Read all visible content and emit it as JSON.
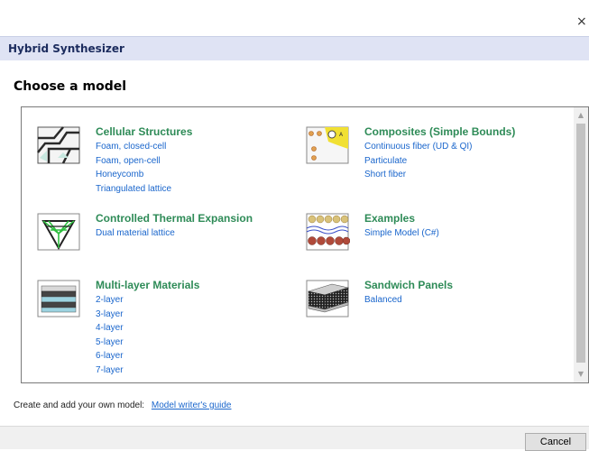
{
  "window": {
    "close_glyph": "×"
  },
  "header": {
    "title": "Hybrid Synthesizer"
  },
  "heading": "Choose a model",
  "categories": [
    {
      "title": "Cellular Structures",
      "icon": "cellular-structure-icon",
      "items": [
        "Foam, closed-cell",
        "Foam, open-cell",
        "Honeycomb",
        "Triangulated lattice"
      ]
    },
    {
      "title": "Composites (Simple Bounds)",
      "icon": "composite-icon",
      "items": [
        "Continuous fiber (UD & QI)",
        "Particulate",
        "Short fiber"
      ]
    },
    {
      "title": "Controlled Thermal Expansion",
      "icon": "lattice-icon",
      "items": [
        "Dual material lattice"
      ]
    },
    {
      "title": "Examples",
      "icon": "examples-icon",
      "items": [
        "Simple Model (C#)"
      ]
    },
    {
      "title": "Multi-layer Materials",
      "icon": "multilayer-icon",
      "items": [
        "2-layer",
        "3-layer",
        "4-layer",
        "5-layer",
        "6-layer",
        "7-layer"
      ]
    },
    {
      "title": "Sandwich Panels",
      "icon": "sandwich-panel-icon",
      "items": [
        "Balanced"
      ]
    }
  ],
  "footer": {
    "text": "Create and add your own model:",
    "link": "Model writer's guide"
  },
  "buttons": {
    "cancel": "Cancel"
  },
  "colors": {
    "category_title": "#2e8b57",
    "link": "#1a66cc",
    "header_bg": "#dfe3f4"
  }
}
